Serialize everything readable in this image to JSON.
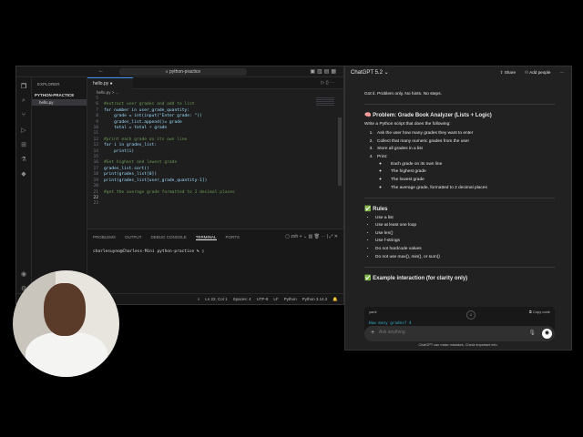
{
  "vscode": {
    "search": "python-practice",
    "sidebar": {
      "title": "EXPLORER",
      "project": "PYTHON-PRACTICE",
      "files": [
        "hello.py"
      ]
    },
    "tab": "hello.py",
    "breadcrumb": "hello.py > ...",
    "code": [
      {
        "n": "5",
        "t": ""
      },
      {
        "n": "6",
        "t": "#extract user grades and add to list",
        "c": true
      },
      {
        "n": "7",
        "t": "for number in user_grade_quantity:"
      },
      {
        "n": "8",
        "t": "    grade = int(input(\"Enter grade: \"))"
      },
      {
        "n": "9",
        "t": "    grades_list.append()= grade"
      },
      {
        "n": "10",
        "t": "    total = total + grade"
      },
      {
        "n": "11",
        "t": ""
      },
      {
        "n": "12",
        "t": "#print each grade on its own line",
        "c": true
      },
      {
        "n": "13",
        "t": "for i in grades_list:"
      },
      {
        "n": "14",
        "t": "    print(i)"
      },
      {
        "n": "15",
        "t": ""
      },
      {
        "n": "16",
        "t": "#Get highest and lowest grade",
        "c": true
      },
      {
        "n": "17",
        "t": "grades_list.sort()"
      },
      {
        "n": "18",
        "t": "print(grades_list[0])"
      },
      {
        "n": "19",
        "t": "print(grades_list[user_grade_quantity-1])"
      },
      {
        "n": "20",
        "t": ""
      },
      {
        "n": "21",
        "t": "#get the average grade formatted to 2 decimal places",
        "c": true
      },
      {
        "n": "22",
        "t": ""
      },
      {
        "n": "23",
        "t": ""
      }
    ],
    "panel_tabs": [
      "PROBLEMS",
      "OUTPUT",
      "DEBUG CONSOLE",
      "TERMINAL",
      "PORTS"
    ],
    "terminal_shell": "zsh",
    "terminal_line": "charlesuyno@Charless-Mini python-practice % ",
    "status": {
      "position": "Ln 22, Col 1",
      "spaces": "Spaces: 4",
      "encoding": "UTF-8",
      "eol": "LF",
      "language": "Python",
      "interpreter": "Python 3.14.2"
    }
  },
  "chatgpt": {
    "model": "ChatGPT 5.2",
    "share": "Share",
    "add_people": "Add people",
    "intro": "Got it. Problem only. No hints. No steps.",
    "problem_title": "🧠 Problem: Grade Book Analyzer (Lists + Logic)",
    "problem_desc": "Write a Python script that does the following:",
    "steps": [
      "Ask the user how many grades they want to enter",
      "Collect that many numeric grades from the user",
      "Store all grades in a list",
      "Print:"
    ],
    "print_items": [
      "Each grade on its own line",
      "The highest grade",
      "The lowest grade",
      "The average grade, formatted to 2 decimal places"
    ],
    "rules_title": "✅ Rules",
    "rules": [
      "Use a list",
      "Use at least one loop",
      "Use len()",
      "Use f-strings",
      "Do not hardcode values",
      "Do not use max(), min(), or sum()"
    ],
    "example_title": "✅ Example interaction (for clarity only)",
    "code_lang": "yaml",
    "copy_code": "Copy code",
    "code_line": "How many grades? 4",
    "placeholder": "Ask anything",
    "disclaimer": "ChatGPT can make mistakes. Check important info."
  }
}
